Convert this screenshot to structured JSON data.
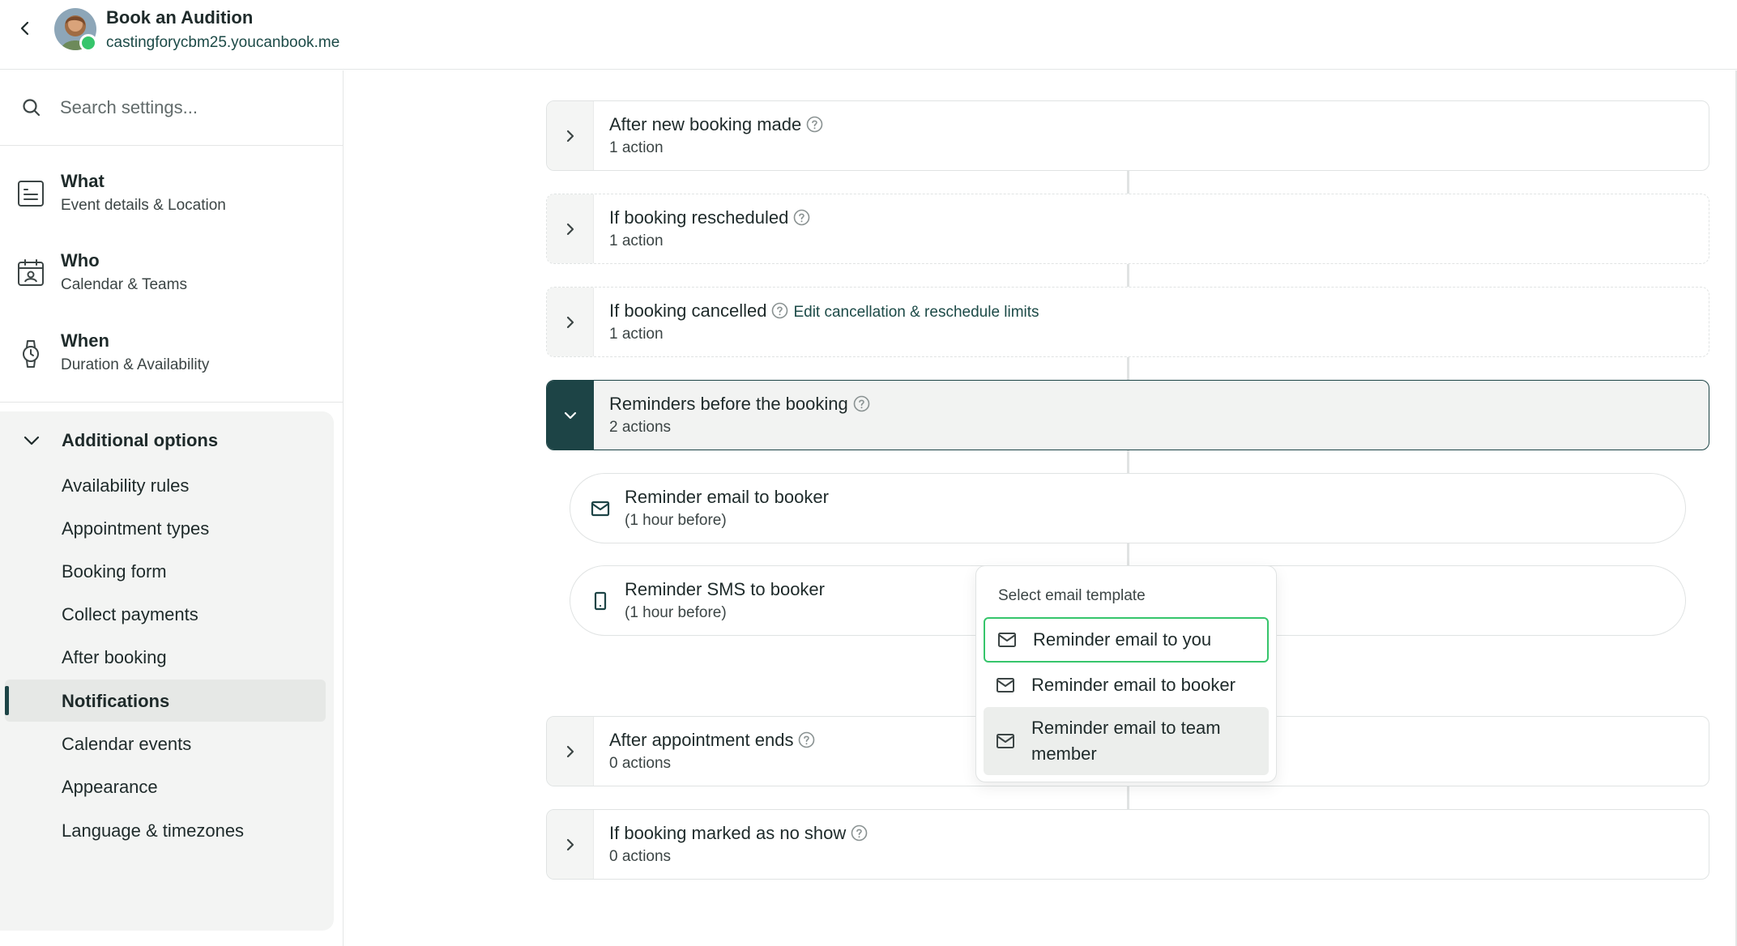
{
  "header": {
    "title": "Book an Audition",
    "url": "castingforycbm25.youcanbook.me"
  },
  "sidebar": {
    "search_placeholder": "Search settings...",
    "sections": [
      {
        "title": "What",
        "subtitle": "Event details & Location",
        "icon": "document-list-icon"
      },
      {
        "title": "Who",
        "subtitle": "Calendar & Teams",
        "icon": "calendar-person-icon"
      },
      {
        "title": "When",
        "subtitle": "Duration & Availability",
        "icon": "watch-icon"
      }
    ],
    "additional": {
      "title": "Additional options",
      "items": [
        {
          "label": "Availability rules"
        },
        {
          "label": "Appointment types"
        },
        {
          "label": "Booking form"
        },
        {
          "label": "Collect payments"
        },
        {
          "label": "After booking"
        },
        {
          "label": "Notifications",
          "active": true
        },
        {
          "label": "Calendar events"
        },
        {
          "label": "Appearance"
        },
        {
          "label": "Language & timezones"
        }
      ]
    }
  },
  "main": {
    "triggers": [
      {
        "title": "After new booking made",
        "subtitle": "1 action"
      },
      {
        "title": "If booking rescheduled",
        "subtitle": "1 action"
      },
      {
        "title": "If booking cancelled",
        "subtitle": "1 action",
        "link": "Edit cancellation & reschedule limits"
      },
      {
        "title": "Reminders before the booking",
        "subtitle": "2 actions",
        "expanded": true
      },
      {
        "title": "After appointment ends",
        "subtitle": "0 actions"
      },
      {
        "title": "If booking marked as no show",
        "subtitle": "0 actions"
      }
    ],
    "actions": [
      {
        "title": "Reminder email to booker",
        "subtitle": "(1 hour before)",
        "icon": "mail-icon"
      },
      {
        "title": "Reminder SMS to booker",
        "subtitle": "(1 hour before)",
        "icon": "phone-icon"
      }
    ]
  },
  "dropdown": {
    "header": "Select email template",
    "options": [
      {
        "label": "Reminder email to you",
        "state": "focused"
      },
      {
        "label": "Reminder email to booker",
        "state": "normal"
      },
      {
        "label": "Reminder email to team member",
        "state": "hovered"
      }
    ]
  },
  "colors": {
    "accent_dark": "#1d4446",
    "link": "#1c4a47",
    "online": "#36c56b",
    "focus_ring": "#36c56b"
  }
}
